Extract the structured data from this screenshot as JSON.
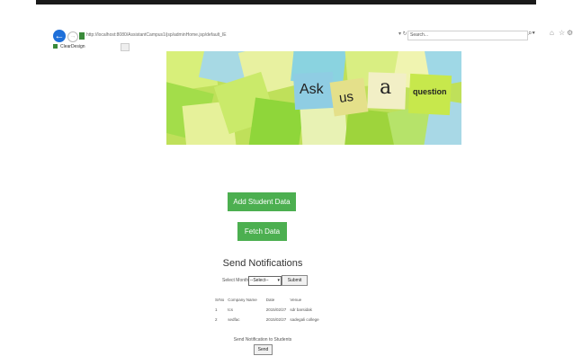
{
  "browser": {
    "address": "http://localhost:8080/AssistantCampus1/jsp/adminHome.jsp/default_IE",
    "tools": "▾ ↻",
    "search_placeholder": "Search...",
    "tab_title": "ClearDesign"
  },
  "banner": {
    "words": [
      "Ask",
      "us",
      "a",
      "question"
    ]
  },
  "buttons": {
    "add_student": "Add Student Data",
    "fetch": "Fetch Data"
  },
  "notifications": {
    "title": "Send Notifications",
    "month_label": "Select Month",
    "month_selected": "--Select--",
    "submit": "Submit",
    "table": {
      "headers": [
        "SrNo",
        "Company Name",
        "Date",
        "Venue"
      ],
      "rows": [
        [
          "1",
          "tcs",
          "2015/02/27",
          "sdr barsidak"
        ],
        [
          "2",
          "sedfac",
          "2015/02/27",
          "sadegali college"
        ]
      ]
    },
    "send_label": "Send Notification to Students",
    "send_button": "Send"
  }
}
